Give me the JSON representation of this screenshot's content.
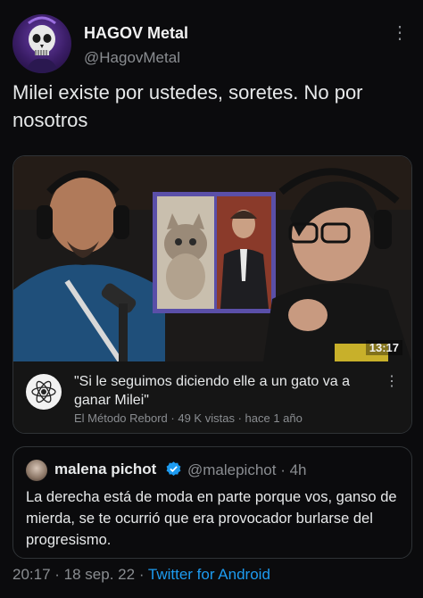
{
  "author": {
    "name": "HAGOV Metal",
    "handle": "@HagovMetal",
    "avatar_icon": "skull-avatar-icon"
  },
  "menu_icon": "more-vertical-icon",
  "tweet": {
    "text": "Milei existe por ustedes, soretes. No por nosotros"
  },
  "video_card": {
    "duration": "13:17",
    "title": "\"Si le seguimos diciendo elle a un gato va a ganar Milei\"",
    "channel": "El Método Rebord",
    "views": "49 K vistas",
    "age": "hace 1 año",
    "channel_icon": "atom-logo-icon"
  },
  "quoted_tweet": {
    "name": "malena pichot",
    "handle": "@malepichot",
    "time": "4h",
    "text": "La derecha está de moda en parte porque vos, ganso de mierda, se te ocurrió que era provocador burlarse del progresismo."
  },
  "footer": {
    "time": "20:17",
    "date": "18 sep. 22",
    "source": "Twitter for Android"
  },
  "colors": {
    "background": "#0b0b0d",
    "link": "#1d9bf0",
    "verified": "#1d9bf0",
    "muted": "#8a8d91",
    "video_accent": "#7a5bd0"
  }
}
